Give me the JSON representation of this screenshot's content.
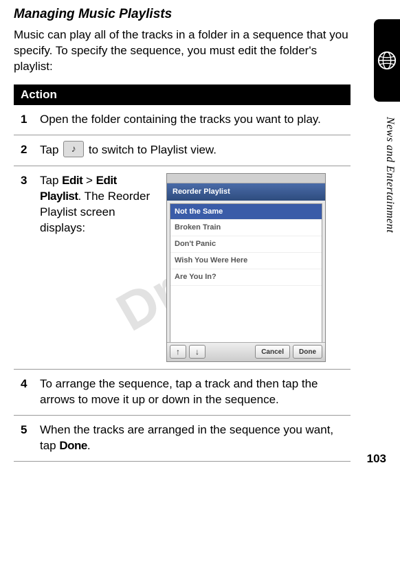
{
  "title": "Managing Music Playlists",
  "intro": "Music can play all of the tracks in a folder in a sequence that you specify. To specify the sequence, you must edit the folder's playlist:",
  "action_header": "Action",
  "steps": {
    "s1": {
      "num": "1",
      "text": "Open the folder containing the tracks you want to play."
    },
    "s2": {
      "num": "2",
      "text_before": "Tap ",
      "text_after": " to switch to Playlist view."
    },
    "s3": {
      "num": "3",
      "text_before": "Tap ",
      "edit_label": "Edit",
      "gt": " > ",
      "edit_playlist_label": "Edit Playlist",
      "text_after": ". The Reorder Playlist screen displays:"
    },
    "s4": {
      "num": "4",
      "text": "To arrange the sequence, tap a track and then tap the arrows to move it up or down in the sequence."
    },
    "s5": {
      "num": "5",
      "text_before": "When the tracks are arranged in the sequence you want, tap ",
      "done_label": "Done",
      "text_after": "."
    }
  },
  "phone": {
    "title": "Reorder Playlist",
    "tracks": [
      "Not the Same",
      "Broken Train",
      "Don't Panic",
      "Wish You Were Here",
      "Are You In?"
    ],
    "cancel_label": "Cancel",
    "done_label": "Done",
    "up_arrow": "↑",
    "down_arrow": "↓"
  },
  "side_label": "News and Entertainment",
  "page_number": "103",
  "watermark": "Draft",
  "icons": {
    "music_note": "♪"
  }
}
